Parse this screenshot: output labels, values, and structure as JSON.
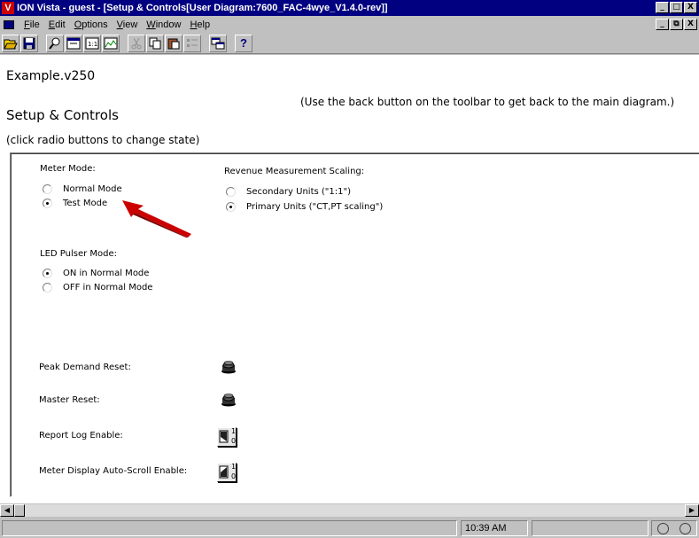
{
  "window": {
    "title": "ION Vista - guest - [Setup & Controls[User Diagram:7600_FAC-4wye_V1.4.0-rev]]",
    "app_icon": "V",
    "minimize": "_",
    "maximize": "□",
    "close": "X"
  },
  "menu": {
    "items": [
      {
        "underline": "F",
        "rest": "ile"
      },
      {
        "underline": "E",
        "rest": "dit"
      },
      {
        "underline": "O",
        "rest": "ptions"
      },
      {
        "underline": "V",
        "rest": "iew"
      },
      {
        "underline": "W",
        "rest": "indow"
      },
      {
        "underline": "H",
        "rest": "elp"
      }
    ],
    "mdi_minimize": "_",
    "mdi_restore": "⧉",
    "mdi_close": "X"
  },
  "toolbar": {
    "icons": [
      "open-icon",
      "save-icon",
      "find-icon",
      "view-icon",
      "scale-icon",
      "diagram-icon",
      "cut-icon",
      "copy-icon",
      "paste-icon",
      "list-icon",
      "window-icon",
      "help-icon"
    ],
    "help_label": "?"
  },
  "content": {
    "doc_title": "Example.v250",
    "back_note": "(Use the back button on the toolbar to get back to the main diagram.)",
    "section_title": "Setup & Controls",
    "click_note": "(click radio buttons to change state)",
    "meter_mode": {
      "label": "Meter Mode:",
      "options": [
        {
          "label": "Normal Mode",
          "checked": false
        },
        {
          "label": "Test Mode",
          "checked": true
        }
      ]
    },
    "revenue_scaling": {
      "label": "Revenue Measurement Scaling:",
      "options": [
        {
          "label": "Secondary Units (\"1:1\")",
          "checked": false
        },
        {
          "label": "Primary Units (\"CT,PT scaling\")",
          "checked": true
        }
      ]
    },
    "led_pulser": {
      "label": "LED Pulser Mode:",
      "options": [
        {
          "label": "ON in Normal Mode",
          "checked": true
        },
        {
          "label": "OFF in Normal Mode",
          "checked": false
        }
      ]
    },
    "controls": {
      "peak_demand_reset": "Peak Demand Reset:",
      "master_reset": "Master Reset:",
      "report_log_enable": "Report Log Enable:",
      "auto_scroll_enable": "Meter Display Auto-Scroll Enable:"
    },
    "toggle_on": "1",
    "toggle_off": "0",
    "arrow_color": "#cc0000"
  },
  "statusbar": {
    "time": "10:39 AM"
  }
}
